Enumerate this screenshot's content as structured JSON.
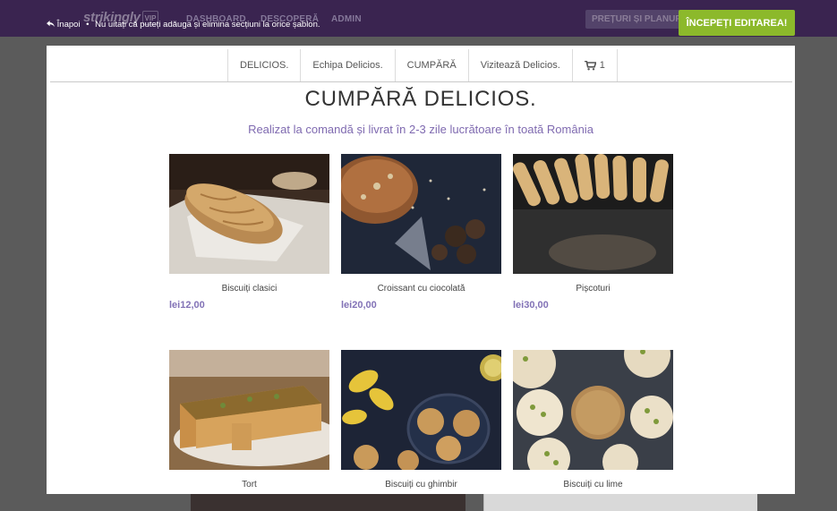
{
  "topbar": {
    "brand": "strikingly",
    "vip": "VIP",
    "nav": [
      "DASHBOARD",
      "DESCOPERĂ",
      "ADMIN"
    ],
    "plans_label": "PREȚURI ȘI PLANURI",
    "edit_button": "ÎNCEPEȚI EDITAREA!",
    "back_label": "Înapoi",
    "hint": "Nu uitați că puteți adăuga și elimina secțiuni la orice șablon."
  },
  "menu": {
    "items": [
      "DELICIOS.",
      "Echipa Delicios.",
      "CUMPĂRĂ",
      "Vizitează Delicios."
    ],
    "cart_count": "1"
  },
  "section": {
    "title": "CUMPĂRĂ DELICIOS.",
    "subtitle": "Realizat la comandă și livrat în 2-3 zile lucrătoare în toată România"
  },
  "products": [
    {
      "name": "Biscuiți clasici",
      "price": "lei12,00"
    },
    {
      "name": "Croissant cu ciocolată",
      "price": "lei20,00"
    },
    {
      "name": "Pișcoturi",
      "price": "lei30,00"
    },
    {
      "name": "Tort",
      "price": ""
    },
    {
      "name": "Biscuiți cu ghimbir",
      "price": ""
    },
    {
      "name": "Biscuiți cu lime",
      "price": ""
    }
  ],
  "colors": {
    "topbar": "#3a2450",
    "accent_green": "#8cb92b",
    "accent_purple": "#7f6ab0"
  }
}
